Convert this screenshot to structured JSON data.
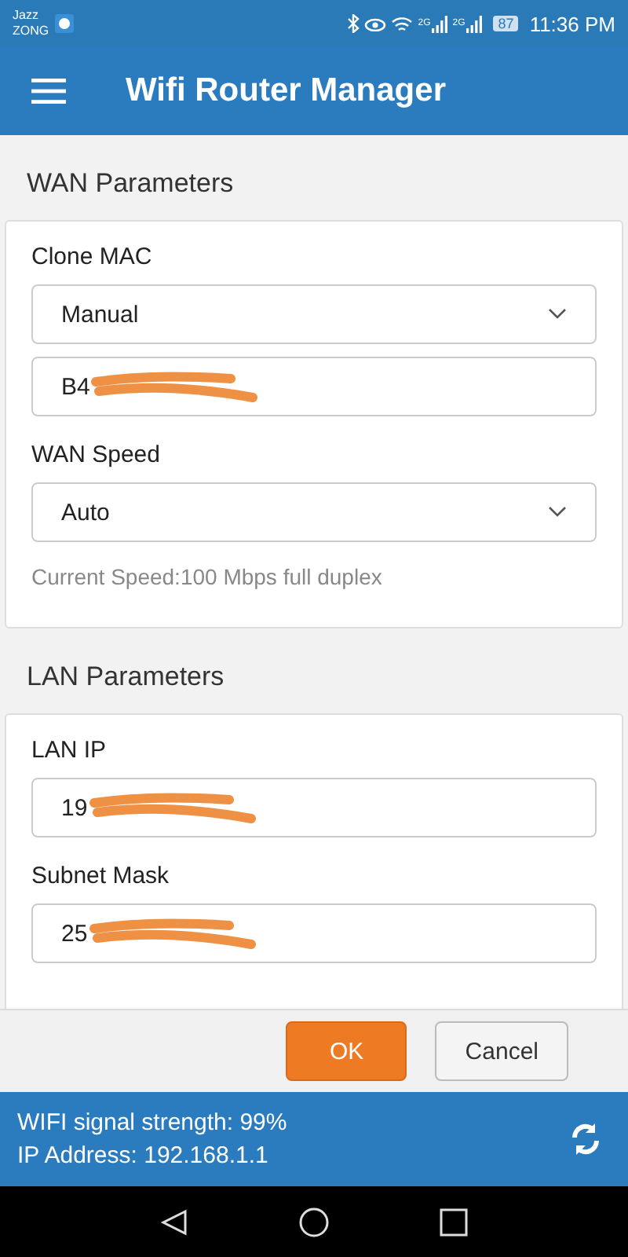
{
  "status_bar": {
    "carrier_lines": [
      "Jazz",
      "ZONG"
    ],
    "network_labels": [
      "2G",
      "2G"
    ],
    "battery": "87",
    "time": "11:36 PM"
  },
  "app_bar": {
    "title": "Wifi Router Manager"
  },
  "sections": [
    {
      "title": "WAN Parameters",
      "fields": [
        {
          "kind": "select",
          "label": "Clone MAC",
          "value": "Manual"
        },
        {
          "kind": "input",
          "value": "B4",
          "redacted": true
        },
        {
          "kind": "select",
          "label": "WAN Speed",
          "value": "Auto"
        },
        {
          "kind": "note",
          "text": "Current Speed:100 Mbps full duplex"
        }
      ]
    },
    {
      "title": "LAN Parameters",
      "fields": [
        {
          "kind": "input",
          "label": "LAN IP",
          "value": "19",
          "redacted": true
        },
        {
          "kind": "input",
          "label": "Subnet Mask",
          "value": "25",
          "redacted": true
        }
      ]
    }
  ],
  "buttons": [
    {
      "label": "OK",
      "primary": true
    },
    {
      "label": "Cancel",
      "primary": false
    }
  ],
  "footer": {
    "lines": [
      "WIFI signal strength: 99%",
      "IP Address: 192.168.1.1"
    ]
  }
}
